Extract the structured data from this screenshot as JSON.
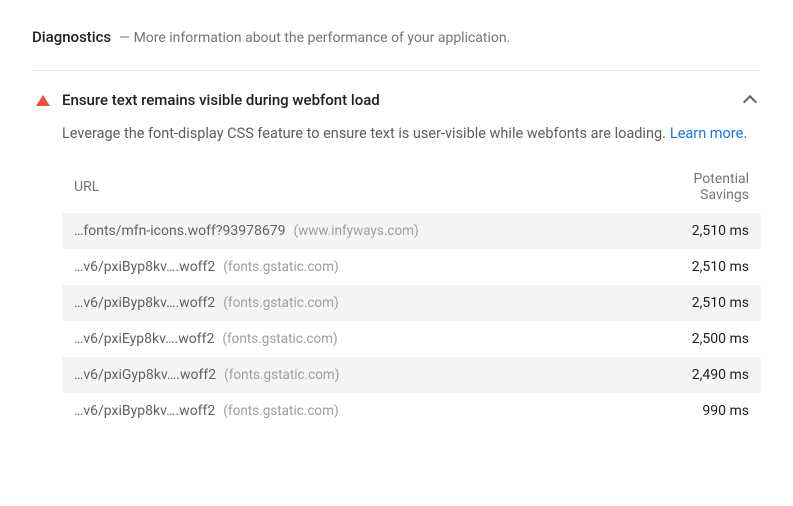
{
  "section": {
    "title": "Diagnostics",
    "subtitle": "More information about the performance of your application."
  },
  "audit": {
    "title": "Ensure text remains visible during webfont load",
    "description": "Leverage the font-display CSS feature to ensure text is user-visible while webfonts are loading.",
    "learn_more": "Learn more",
    "table": {
      "headers": {
        "url": "URL",
        "savings": "Potential Savings"
      },
      "rows": [
        {
          "path": "…fonts/mfn-icons.woff?93978679",
          "host": "www.infyways.com",
          "savings": "2,510 ms"
        },
        {
          "path": "…v6/pxiByp8kv….woff2",
          "host": "fonts.gstatic.com",
          "savings": "2,510 ms"
        },
        {
          "path": "…v6/pxiByp8kv….woff2",
          "host": "fonts.gstatic.com",
          "savings": "2,510 ms"
        },
        {
          "path": "…v6/pxiEyp8kv….woff2",
          "host": "fonts.gstatic.com",
          "savings": "2,500 ms"
        },
        {
          "path": "…v6/pxiGyp8kv….woff2",
          "host": "fonts.gstatic.com",
          "savings": "2,490 ms"
        },
        {
          "path": "…v6/pxiByp8kv….woff2",
          "host": "fonts.gstatic.com",
          "savings": "990 ms"
        }
      ]
    }
  }
}
